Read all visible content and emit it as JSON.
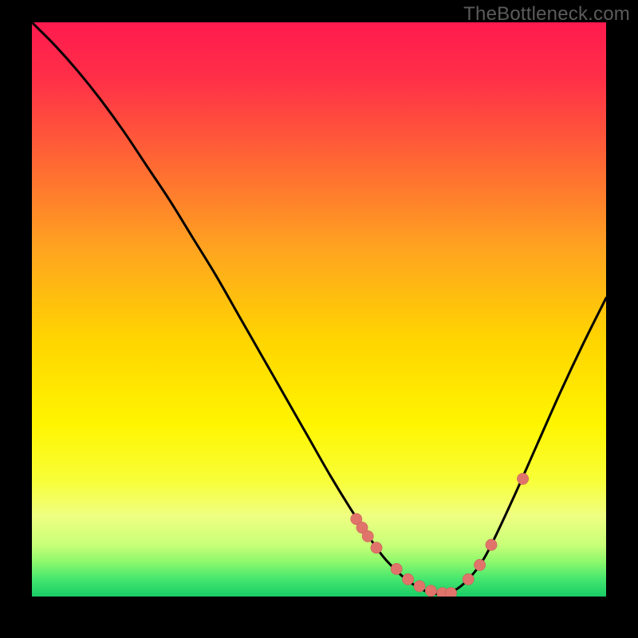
{
  "watermark": "TheBottleneck.com",
  "colors": {
    "background": "#000000",
    "curve_stroke": "#000000",
    "marker_fill": "#e0746b",
    "marker_stroke": "#c25a52",
    "gradient_stops": [
      {
        "offset": 0.0,
        "color": "#ff1a4e"
      },
      {
        "offset": 0.1,
        "color": "#ff3048"
      },
      {
        "offset": 0.25,
        "color": "#ff6a33"
      },
      {
        "offset": 0.4,
        "color": "#ffa61f"
      },
      {
        "offset": 0.55,
        "color": "#ffd400"
      },
      {
        "offset": 0.7,
        "color": "#fff500"
      },
      {
        "offset": 0.8,
        "color": "#f8ff3a"
      },
      {
        "offset": 0.86,
        "color": "#efff82"
      },
      {
        "offset": 0.91,
        "color": "#c8ff78"
      },
      {
        "offset": 0.94,
        "color": "#8cf86c"
      },
      {
        "offset": 0.97,
        "color": "#44e66e"
      },
      {
        "offset": 1.0,
        "color": "#19cc66"
      }
    ]
  },
  "chart_data": {
    "type": "line",
    "title": "",
    "xlabel": "",
    "ylabel": "",
    "xlim": [
      0,
      100
    ],
    "ylim": [
      0,
      100
    ],
    "grid": false,
    "legend": false,
    "series": [
      {
        "name": "curve",
        "x": [
          0,
          4,
          8,
          12,
          16,
          20,
          24,
          28,
          32,
          36,
          40,
          44,
          48,
          52,
          56,
          60,
          62,
          64,
          66,
          68,
          70,
          72,
          74,
          76,
          78,
          80,
          84,
          88,
          92,
          96,
          100
        ],
        "y": [
          100,
          96,
          91.5,
          86.5,
          81,
          75,
          69,
          62.5,
          56,
          49,
          42,
          35,
          28,
          21,
          14.5,
          8.5,
          6.0,
          4.0,
          2.4,
          1.2,
          0.5,
          0.5,
          1.3,
          3.0,
          5.5,
          9.0,
          17.5,
          26.5,
          35.5,
          44.0,
          52.0
        ]
      }
    ],
    "markers": {
      "name": "highlighted-points",
      "x": [
        56.5,
        57.5,
        58.5,
        60.0,
        63.5,
        65.5,
        67.5,
        69.5,
        71.5,
        73.0,
        76.0,
        78.0,
        80.0,
        85.5
      ],
      "y": [
        13.5,
        12.0,
        10.5,
        8.5,
        4.8,
        3.0,
        1.8,
        1.0,
        0.6,
        0.6,
        3.0,
        5.5,
        9.0,
        20.5
      ]
    }
  }
}
